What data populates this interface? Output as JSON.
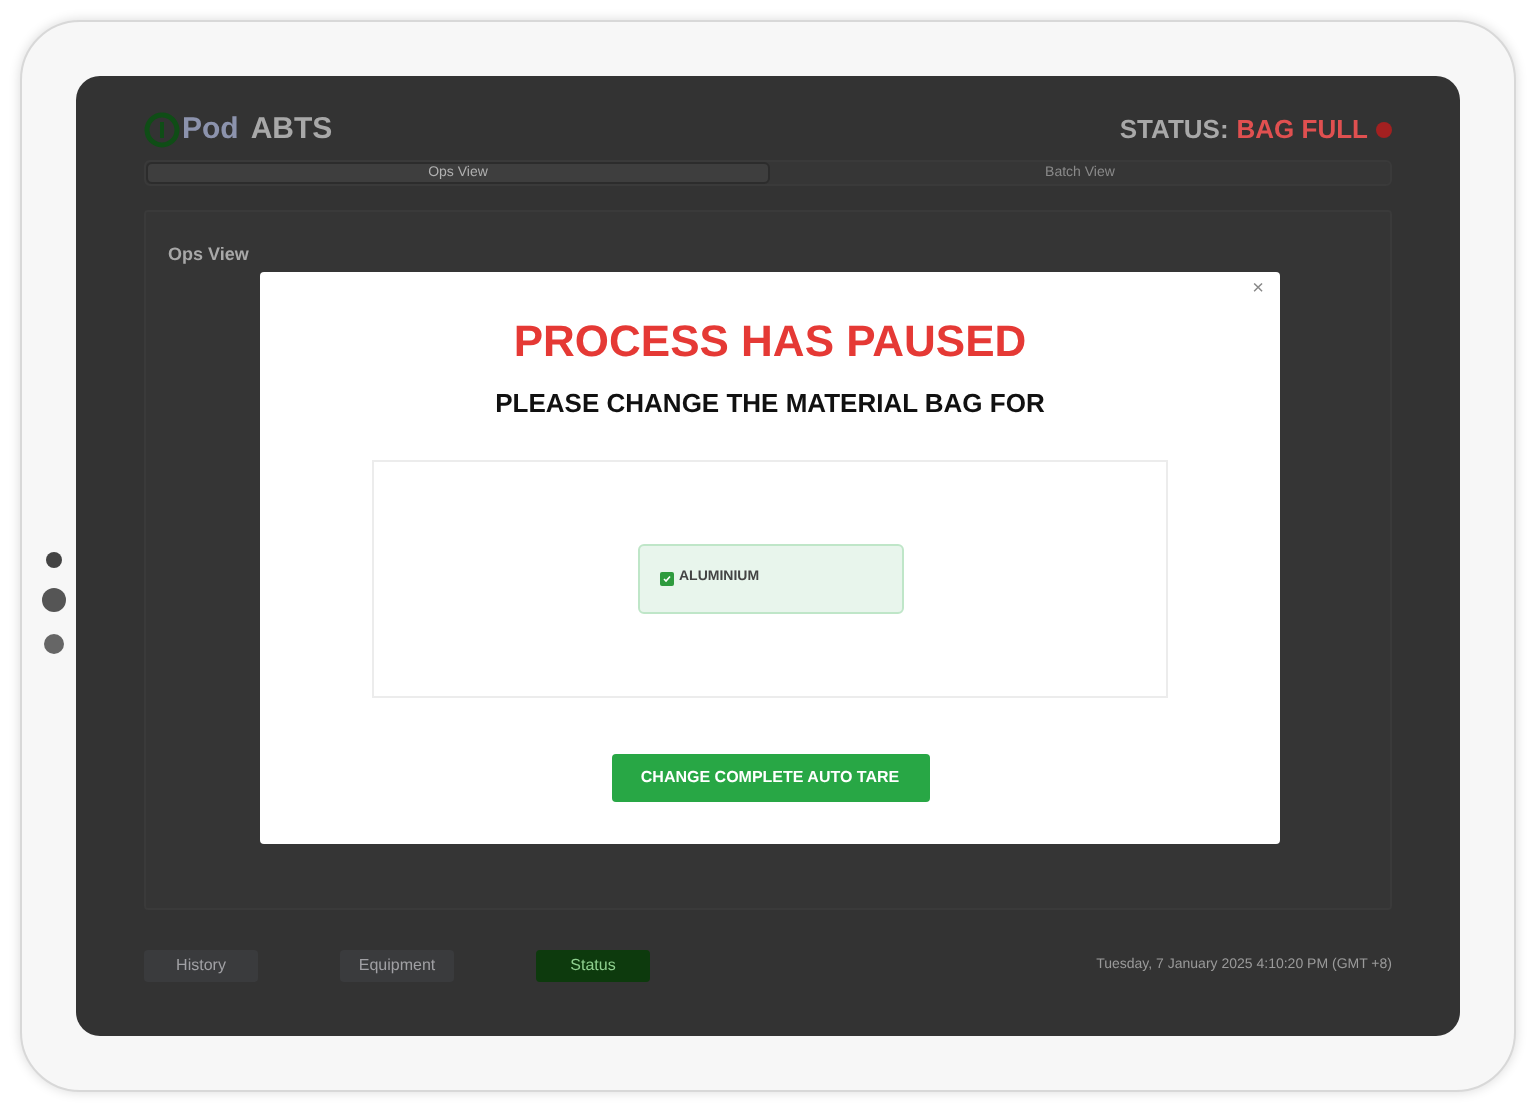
{
  "header": {
    "logo_text": "Pod",
    "app_name": "ABTS",
    "status_label": "STATUS:",
    "status_value": "BAG FULL"
  },
  "tabs": [
    {
      "label": "Ops View",
      "selected": true
    },
    {
      "label": "Batch View",
      "selected": false
    }
  ],
  "panel": {
    "title": "Ops View"
  },
  "footer": {
    "buttons": [
      {
        "label": "History",
        "kind": "plain"
      },
      {
        "label": "Equipment",
        "kind": "plain"
      },
      {
        "label": "Status",
        "kind": "primary"
      }
    ],
    "datetime": "Tuesday, 7 January 2025 4:10:20 PM (GMT +8)"
  },
  "modal": {
    "close": "×",
    "title": "PROCESS HAS PAUSED",
    "subtitle": "PLEASE CHANGE THE MATERIAL BAG FOR",
    "materials": [
      {
        "label": "ALUMINIUM",
        "checked": true
      }
    ],
    "button": "CHANGE COMPLETE AUTO TARE"
  }
}
